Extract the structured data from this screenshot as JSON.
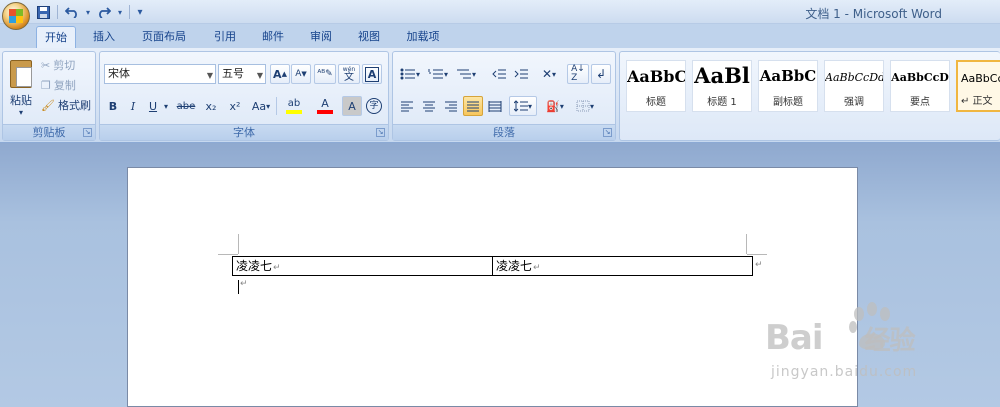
{
  "window": {
    "title": "文档 1 - Microsoft Word"
  },
  "qat": {
    "save_icon": "save-icon",
    "undo_icon": "undo-icon",
    "redo_icon": "redo-icon",
    "customize": "▾"
  },
  "tabs": [
    {
      "label": "开始",
      "active": true
    },
    {
      "label": "插入"
    },
    {
      "label": "页面布局"
    },
    {
      "label": "引用"
    },
    {
      "label": "邮件"
    },
    {
      "label": "审阅"
    },
    {
      "label": "视图"
    },
    {
      "label": "加载项"
    }
  ],
  "clipboard": {
    "paste_label": "粘贴",
    "cut_label": "剪切",
    "copy_label": "复制",
    "format_painter_label": "格式刷",
    "group_label": "剪贴板"
  },
  "font": {
    "font_name": "宋体",
    "font_size": "五号",
    "grow": "A",
    "shrink": "A",
    "pinyin": "wén",
    "char_border": "A",
    "bold": "B",
    "italic": "I",
    "underline": "U",
    "strike": "abe",
    "subscript": "x₂",
    "superscript": "x²",
    "change_case": "Aa",
    "highlight": "ab",
    "font_color": "A",
    "char_shading": "A",
    "enclose": "字",
    "group_label": "字体"
  },
  "paragraph": {
    "group_label": "段落"
  },
  "styles": [
    {
      "sample": "AaBbC",
      "name": "标题"
    },
    {
      "sample": "AaBl",
      "name": "标题 1"
    },
    {
      "sample": "AaBbC",
      "name": "副标题"
    },
    {
      "sample": "AaBbCcDd",
      "name": "强调"
    },
    {
      "sample": "AaBbCcD",
      "name": "要点"
    },
    {
      "sample": "AaBbCc",
      "name": "↵ 正文",
      "active": true
    }
  ],
  "document": {
    "table_cells": [
      "凌凌七",
      "凌凌七"
    ],
    "para_mark": "↵"
  },
  "watermark": {
    "main": "Bai",
    "tail": "经验",
    "sub": "jingyan.baidu.com"
  },
  "colors": {
    "highlight": "#ffff00",
    "font_color": "#ff0000",
    "active_style": "#f0b640"
  }
}
